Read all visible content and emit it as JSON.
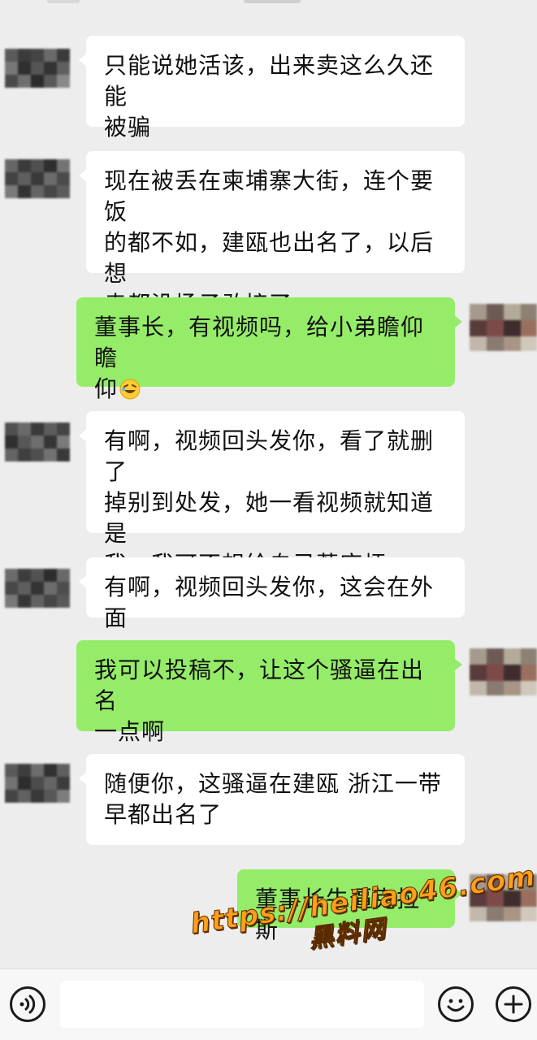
{
  "messages": [
    {
      "side": "in",
      "text": "只能说她活该，出来卖这么久还能\n被骗"
    },
    {
      "side": "in",
      "text": "现在被丢在柬埔寨大街，连个要饭\n的都不如，建瓯也出名了，以后想\n卖都没场子敢接了"
    },
    {
      "side": "out",
      "text": "董事长，有视频吗，给小弟瞻仰瞻\n仰",
      "emoji": "rofl-emoji"
    },
    {
      "side": "in",
      "text": "有啊，视频回头发你，看了就删了\n掉别到处发，她一看视频就知道是\n我，我可不想给自己惹麻烦"
    },
    {
      "side": "in",
      "text": "有啊，视频回头发你，这会在外面"
    },
    {
      "side": "out",
      "text": "我可以投稿不，让这个骚逼在出名\n一点啊"
    },
    {
      "side": "in",
      "text": "随便你，这骚逼在建瓯 浙江一带\n早都出名了"
    },
    {
      "side": "out",
      "text": "董事长牛逼克拉斯"
    }
  ],
  "watermark": {
    "url": "https://heiliao46.com",
    "name": "黑料网"
  },
  "input_bar": {
    "voice_icon": "voice-icon",
    "emoji_icon": "emoji-icon",
    "plus_icon": "plus-icon",
    "message_value": ""
  },
  "colors": {
    "background": "#ededed",
    "incoming_bubble": "#ffffff",
    "outgoing_bubble": "#95ec69",
    "watermark": "#ff9f1a"
  }
}
